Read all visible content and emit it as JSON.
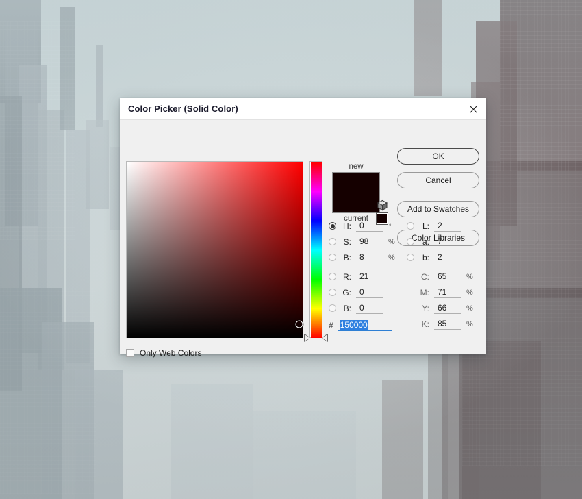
{
  "dialog": {
    "title": "Color Picker (Solid Color)",
    "close_icon": "close-icon"
  },
  "buttons": {
    "ok": "OK",
    "cancel": "Cancel",
    "add_to_swatches": "Add to Swatches",
    "color_libraries": "Color Libraries"
  },
  "options": {
    "only_web_colors_label": "Only Web Colors",
    "only_web_colors_checked": false
  },
  "preview": {
    "new_label": "new",
    "current_label": "current",
    "new_color": "#150000",
    "current_color": "#150000",
    "websafe_color": "#150000",
    "cube_icon": "out-of-gamut-cube-icon"
  },
  "color": {
    "hex": "150000",
    "hex_prefix": "#",
    "selected_model": "H",
    "hsb": [
      {
        "key": "H",
        "label": "H:",
        "value": "0",
        "unit": "°",
        "selected": true
      },
      {
        "key": "S",
        "label": "S:",
        "value": "98",
        "unit": "%",
        "selected": false
      },
      {
        "key": "B",
        "label": "B:",
        "value": "8",
        "unit": "%",
        "selected": false
      }
    ],
    "rgb": [
      {
        "key": "R",
        "label": "R:",
        "value": "21",
        "unit": "",
        "selected": false
      },
      {
        "key": "G",
        "label": "G:",
        "value": "0",
        "unit": "",
        "selected": false
      },
      {
        "key": "B",
        "label": "B:",
        "value": "0",
        "unit": "",
        "selected": false
      }
    ],
    "lab": [
      {
        "key": "L",
        "label": "L:",
        "value": "2",
        "unit": "",
        "selected": false
      },
      {
        "key": "a",
        "label": "a:",
        "value": "7",
        "unit": "",
        "selected": false
      },
      {
        "key": "b",
        "label": "b:",
        "value": "2",
        "unit": "",
        "selected": false
      }
    ],
    "cmyk": [
      {
        "key": "C",
        "label": "C:",
        "value": "65",
        "unit": "%"
      },
      {
        "key": "M",
        "label": "M:",
        "value": "71",
        "unit": "%"
      },
      {
        "key": "Y",
        "label": "Y:",
        "value": "66",
        "unit": "%"
      },
      {
        "key": "K",
        "label": "K:",
        "value": "85",
        "unit": "%"
      }
    ],
    "field_hue_color": "#ff0000",
    "cursor_x_pct": 98,
    "cursor_y_pct": 92,
    "hue_marker_pct": 100
  }
}
